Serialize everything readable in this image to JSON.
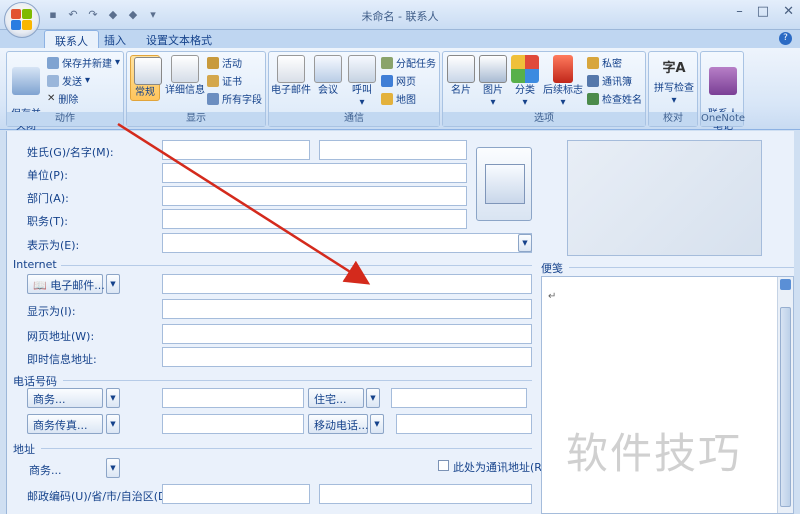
{
  "window": {
    "title": "未命名 - 联系人",
    "controls": [
      "minimize-icon",
      "maximize-icon",
      "close-icon"
    ]
  },
  "qat": [
    "save-icon",
    "undo-icon",
    "redo-icon",
    "up-icon",
    "down-icon",
    "customize-icon"
  ],
  "tabs": [
    {
      "label": "联系人",
      "active": true
    },
    {
      "label": "插入",
      "active": false
    },
    {
      "label": "设置文本格式",
      "active": false
    }
  ],
  "ribbon": {
    "actions": {
      "label": "动作",
      "save_close": "保存并\n关闭",
      "save_new": "保存并新建",
      "send": "发送",
      "delete": "删除"
    },
    "show": {
      "label": "显示",
      "general": "常规",
      "details": "详细信息",
      "activities": "活动",
      "certificates": "证书",
      "all_fields": "所有字段"
    },
    "communicate": {
      "label": "通信",
      "email": "电子邮件",
      "meeting": "会议",
      "call": "呼叫",
      "assign_task": "分配任务",
      "web_page": "网页",
      "map": "地图"
    },
    "options": {
      "label": "选项",
      "business_card": "名片",
      "picture": "图片",
      "categorize": "分类",
      "follow_up": "后续标志",
      "private": "私密",
      "address_book": "通讯簿",
      "check_names": "检查姓名"
    },
    "proofing": {
      "label": "校对",
      "spelling": "拼写检查",
      "spelling_glyph": "字A"
    },
    "onenote": {
      "label": "OneNote",
      "contact_notes": "联系人\n笔记"
    }
  },
  "form": {
    "name_label": "姓氏(G)/名字(M):",
    "company_label": "单位(P):",
    "department_label": "部门(A):",
    "job_title_label": "职务(T):",
    "file_as_label": "表示为(E):",
    "internet_section": "Internet",
    "email_button": "电子邮件...",
    "display_as_label": "显示为(I):",
    "web_address_label": "网页地址(W):",
    "im_address_label": "即时信息地址:",
    "phone_section": "电话号码",
    "business_button": "商务...",
    "home_button": "住宅...",
    "business_fax_button": "商务传真...",
    "mobile_button": "移动电话...",
    "address_section": "地址",
    "address_business_button": "商务...",
    "mailing_address_label": "此处为通讯地址(R)",
    "postal_label": "邮政编码(U)/省/市/自治区(D):"
  },
  "notes": {
    "label": "便笺",
    "cursor_mark": "↵"
  },
  "watermark": "软件技巧"
}
